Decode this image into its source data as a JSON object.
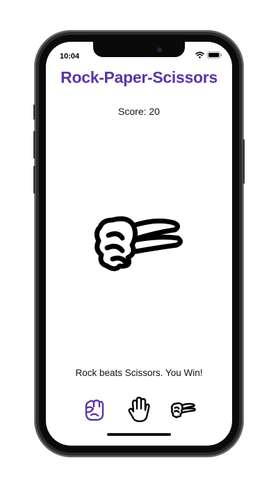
{
  "status_bar": {
    "time": "10:04"
  },
  "app": {
    "title": "Rock-Paper-Scissors",
    "score_text": "Score: 20",
    "result_message": "Rock beats Scissors. You Win!"
  },
  "result_icon": "scissors-hand-icon",
  "choices": [
    {
      "name": "rock",
      "icon": "fist-icon",
      "selected": true
    },
    {
      "name": "paper",
      "icon": "open-hand-icon",
      "selected": false
    },
    {
      "name": "scissors",
      "icon": "scissors-hand-icon",
      "selected": false
    }
  ],
  "colors": {
    "accent": "#5b34a8",
    "text": "#111111",
    "background": "#ffffff"
  }
}
